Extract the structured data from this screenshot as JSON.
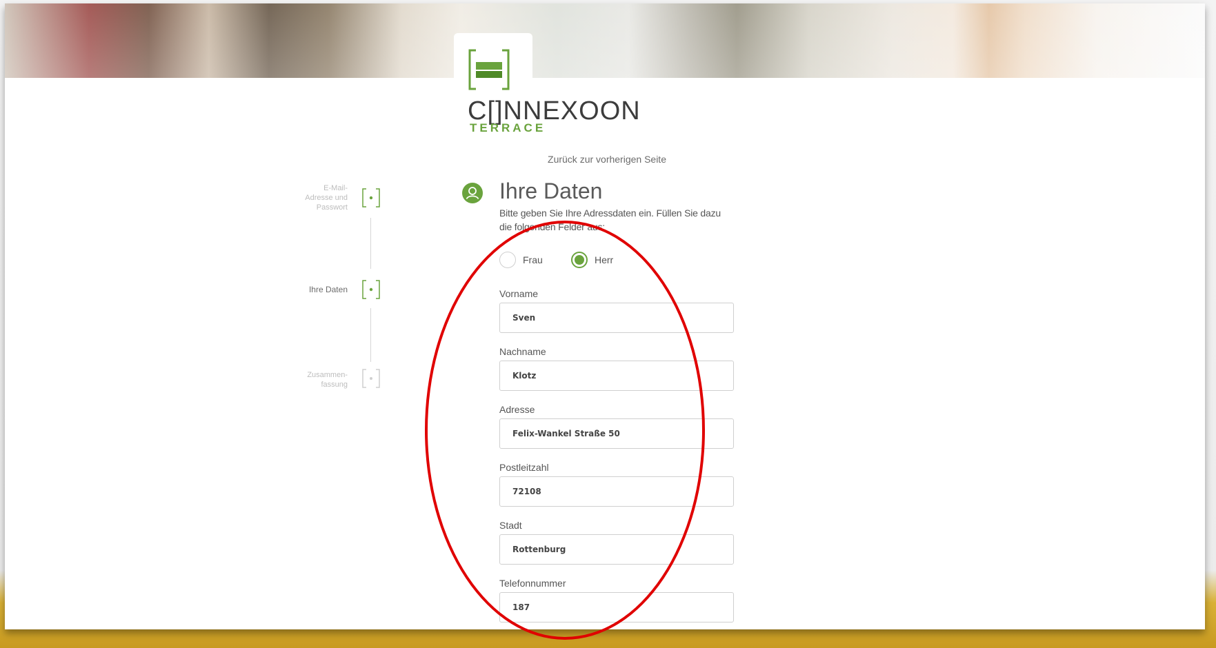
{
  "logo": {
    "word": "C[]NNEXOON",
    "sub": "TERRACE"
  },
  "nav": {
    "back_label": "Zurück zur vorherigen Seite"
  },
  "stepper": {
    "steps": [
      {
        "label": "E-Mail-\nAdresse und\nPasswort",
        "state": "done"
      },
      {
        "label": "Ihre Daten",
        "state": "active"
      },
      {
        "label": "Zusammen-\nfassung",
        "state": "pending"
      }
    ]
  },
  "form": {
    "title": "Ihre Daten",
    "intro": "Bitte geben Sie Ihre Adressdaten ein. Füllen Sie dazu die folgenden Felder aus:",
    "salutation": {
      "options": [
        "Frau",
        "Herr"
      ],
      "selected": "Herr"
    },
    "fields": [
      {
        "label": "Vorname",
        "value": "Sven"
      },
      {
        "label": "Nachname",
        "value": "Klotz"
      },
      {
        "label": "Adresse",
        "value": "Felix-Wankel Straße 50"
      },
      {
        "label": "Postleitzahl",
        "value": "72108"
      },
      {
        "label": "Stadt",
        "value": "Rottenburg"
      },
      {
        "label": "Telefonnummer",
        "value": "187"
      }
    ]
  },
  "colors": {
    "accent": "#6aa33d",
    "annotation": "#e00000",
    "frame": "#c89a20"
  }
}
